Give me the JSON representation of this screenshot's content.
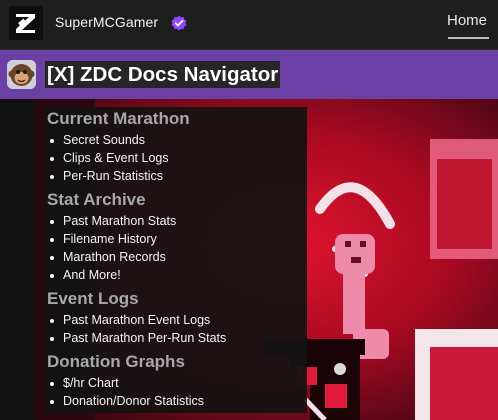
{
  "topbar": {
    "username": "SuperMCGamer",
    "home_label": "Home"
  },
  "header": {
    "title": "[X] ZDC Docs Navigator"
  },
  "sections": [
    {
      "heading": "Current Marathon",
      "items": [
        "Secret Sounds",
        "Clips & Event Logs",
        "Per-Run Statistics"
      ]
    },
    {
      "heading": "Stat Archive",
      "items": [
        "Past Marathon Stats",
        "Filename History",
        "Marathon Records",
        "And More!"
      ]
    },
    {
      "heading": "Event Logs",
      "items": [
        "Past Marathon Event Logs",
        "Past Marathon Per-Run Stats"
      ]
    },
    {
      "heading": "Donation Graphs",
      "items": [
        "$/hr Chart",
        "Donation/Donor Statistics"
      ]
    }
  ],
  "colors": {
    "header_purple": "#6b3fa3",
    "verified_purple": "#9147ff",
    "topbar": "#1e1e1e"
  },
  "icons": {
    "logo": "z-logo-icon",
    "verified": "verified-badge-icon",
    "avatar": "monkey-avatar-icon"
  }
}
